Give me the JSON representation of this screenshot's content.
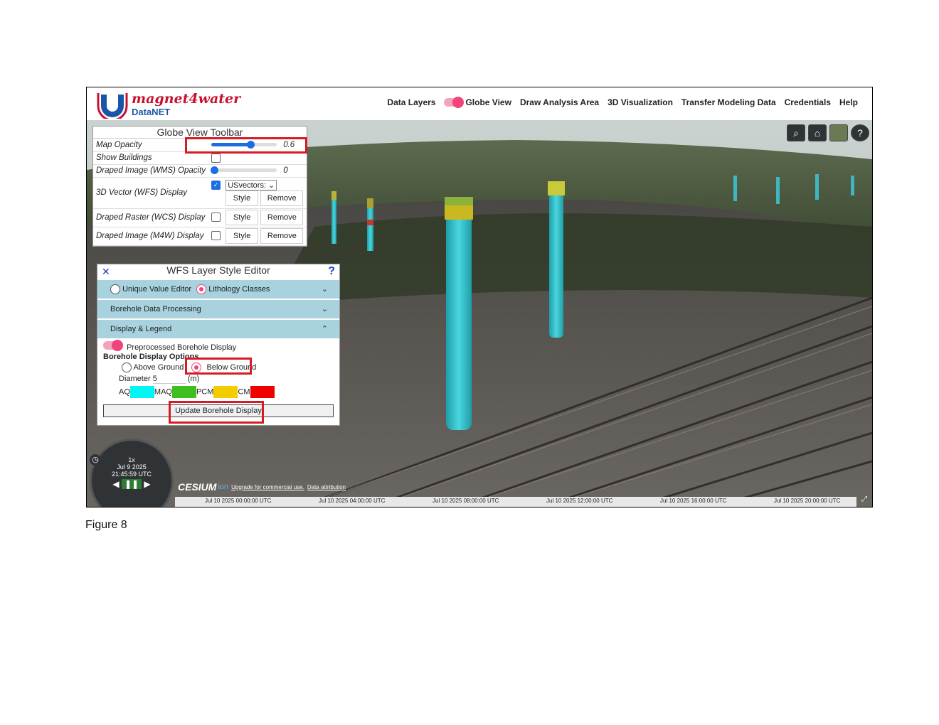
{
  "app": {
    "brand": "magnet4water",
    "sub": "DataNET"
  },
  "nav": {
    "data_layers": "Data Layers",
    "globe_view": "Globe View",
    "draw_area": "Draw Analysis Area",
    "vis3d": "3D Visualization",
    "transfer": "Transfer Modeling Data",
    "credentials": "Credentials",
    "help": "Help"
  },
  "globe_toolbar": {
    "title": "Globe View Toolbar",
    "map_opacity_label": "Map Opacity",
    "map_opacity_value": "0.6",
    "map_opacity": 0.6,
    "show_buildings_label": "Show Buildings",
    "wms_label": "Draped Image (WMS) Opacity",
    "wms_value": "0",
    "wms_opacity": 0,
    "wfs_label": "3D Vector (WFS) Display",
    "wfs_select": "USvectors:",
    "wcs_label": "Draped Raster (WCS) Display",
    "m4w_label": "Draped Image (M4W) Display",
    "style": "Style",
    "remove": "Remove"
  },
  "wfs_editor": {
    "close": "✕",
    "title": "WFS Layer Style Editor",
    "help": "?",
    "unique_value": "Unique Value Editor",
    "lithology": "Lithology Classes",
    "borehole_processing": "Borehole Data Processing",
    "display_legend": "Display & Legend",
    "preprocessed": "Preprocessed Borehole Display",
    "options": "Borehole Display Options",
    "above": "Above Ground",
    "below": "Below Ground",
    "diameter_label": "Diameter",
    "diameter_value": "5",
    "unit": "(m)",
    "classes": [
      {
        "label": "AQ",
        "color": "#00f5f5"
      },
      {
        "label": "MAQ",
        "color": "#3fbf1f"
      },
      {
        "label": "PCM",
        "color": "#f5cc00"
      },
      {
        "label": "CM",
        "color": "#ee0000"
      }
    ],
    "update": "Update Borehole Display"
  },
  "clock": {
    "speed": "1x",
    "date": "Jul 9 2025",
    "time": "21:45:59 UTC"
  },
  "cesium": {
    "logo": "CESIUM",
    "ion": "ion",
    "upgrade": "Upgrade for commercial use.",
    "attribution": "Data attribution"
  },
  "timeline": [
    "Jul 10 2025 00:00:00 UTC",
    "Jul 10 2025 04:00:00 UTC",
    "Jul 10 2025 08:00:00 UTC",
    "Jul 10 2025 12:00:00 UTC",
    "Jul 10 2025 16:00:00 UTC",
    "Jul 10 2025 20:00:00 UTC"
  ],
  "caption": "Figure 8"
}
